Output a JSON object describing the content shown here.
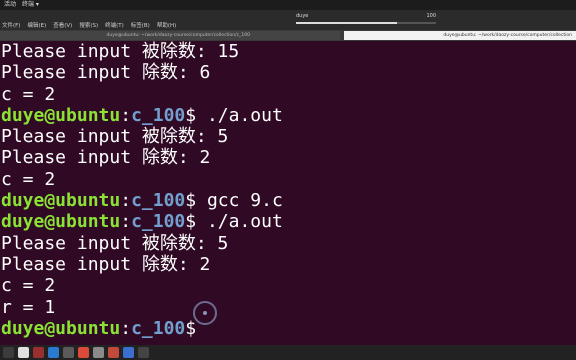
{
  "topbar": {
    "activities": "活动",
    "app_name": "终端 ▾"
  },
  "menubar": {
    "items": [
      "文件(F)",
      "编辑(E)",
      "查看(V)",
      "搜索(S)",
      "终端(T)",
      "标签(B)",
      "帮助(H)"
    ],
    "volume": {
      "label": "duye",
      "value_text": "100",
      "level": 0.72
    }
  },
  "tabs": [
    {
      "title": "duye@ubuntu: ~/work/daozy-course/computer/collection/c_100",
      "active": false
    },
    {
      "title": "duye@ubuntu: ~/work/daozy-course/computer/collection",
      "active": true
    }
  ],
  "terminal": {
    "colors": {
      "background": "#300a24",
      "user": "#8ae234",
      "path": "#729fcf"
    },
    "lines": [
      {
        "text": "Please input 被除数: 15"
      },
      {
        "text": "Please input 除数: 6"
      },
      {
        "text": "c = 2"
      },
      {
        "prompt": {
          "user": "duye@ubuntu",
          "sep": ":",
          "path": "c_100",
          "dollar": "$ "
        },
        "command": "./a.out"
      },
      {
        "text": "Please input 被除数: 5"
      },
      {
        "text": "Please input 除数: 2"
      },
      {
        "text": "c = 2"
      },
      {
        "prompt": {
          "user": "duye@ubuntu",
          "sep": ":",
          "path": "c_100",
          "dollar": "$ "
        },
        "command": "gcc 9.c"
      },
      {
        "prompt": {
          "user": "duye@ubuntu",
          "sep": ":",
          "path": "c_100",
          "dollar": "$ "
        },
        "command": "./a.out"
      },
      {
        "text": "Please input 被除数: 5"
      },
      {
        "text": "Please input 除数: 2"
      },
      {
        "text": "c = 2"
      },
      {
        "text": "r = 1"
      },
      {
        "prompt": {
          "user": "duye@ubuntu",
          "sep": ":",
          "path": "c_100",
          "dollar": "$ "
        },
        "command": ""
      }
    ]
  },
  "dock": {
    "icons": [
      {
        "name": "terminal-icon",
        "color": "#3c3c3c"
      },
      {
        "name": "files-icon",
        "color": "#e0e0e0"
      },
      {
        "name": "screen-record-icon",
        "color": "#9a2f2f"
      },
      {
        "name": "vscode-icon",
        "color": "#2a7bd0"
      },
      {
        "name": "app-icon",
        "color": "#5a5a5a"
      },
      {
        "name": "chrome-icon",
        "color": "#d94c3a"
      },
      {
        "name": "settings-icon",
        "color": "#8a8a8a"
      },
      {
        "name": "text-editor-icon",
        "color": "#c24a3a"
      },
      {
        "name": "player-icon",
        "color": "#3a6fd0"
      },
      {
        "name": "terminal-app-icon",
        "color": "#444444"
      }
    ]
  }
}
